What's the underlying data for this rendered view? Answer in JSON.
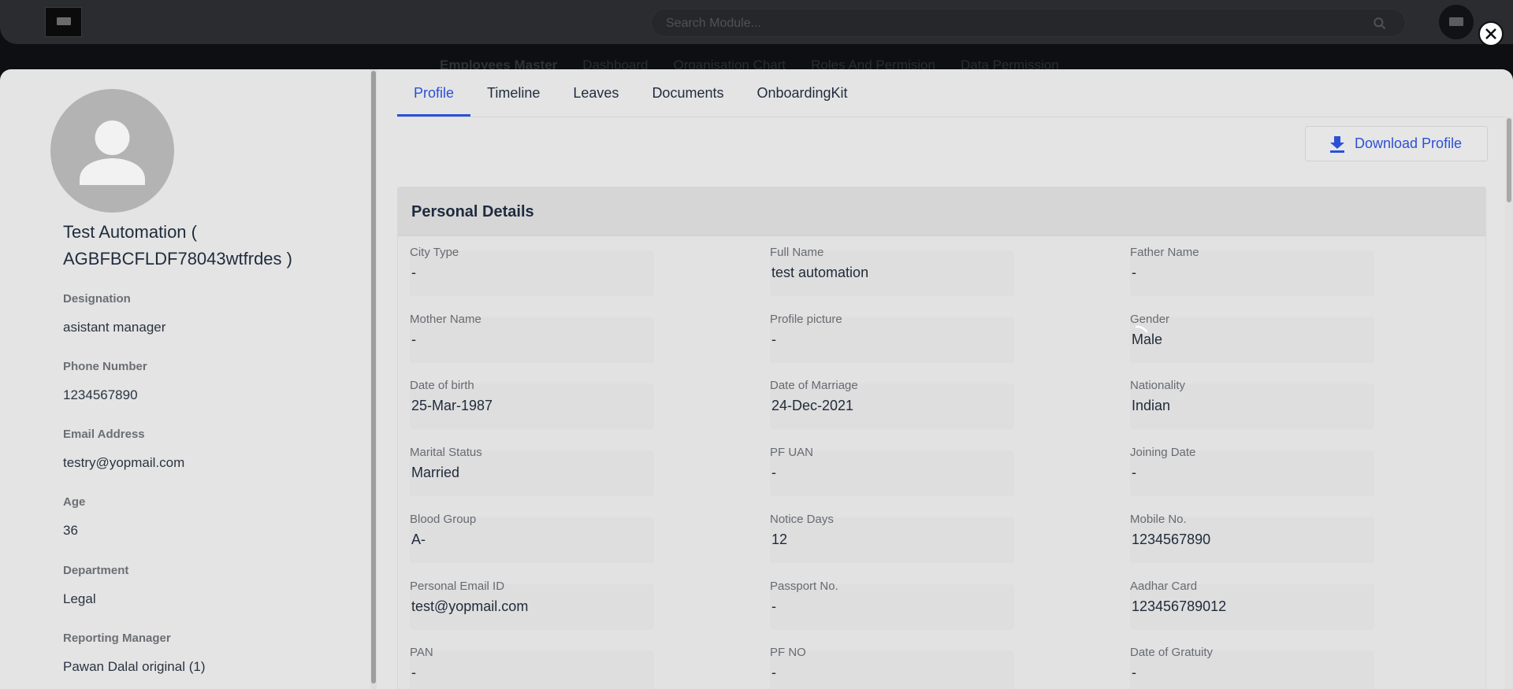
{
  "background": {
    "search_placeholder": "Search Module...",
    "nav": [
      "Employees Master",
      "Dashboard",
      "Organisation Chart",
      "Roles And Permision",
      "Data Permission"
    ]
  },
  "sidebar": {
    "name": "Test Automation ( AGBFBCFLDF78043wtfrdes )",
    "fields": [
      {
        "label": "Designation",
        "value": "asistant manager"
      },
      {
        "label": "Phone Number",
        "value": "1234567890"
      },
      {
        "label": "Email Address",
        "value": "testry@yopmail.com"
      },
      {
        "label": "Age",
        "value": "36"
      },
      {
        "label": "Department",
        "value": "Legal"
      },
      {
        "label": "Reporting Manager",
        "value": "Pawan Dalal original (1)"
      }
    ]
  },
  "tabs": [
    {
      "label": "Profile",
      "active": true
    },
    {
      "label": "Timeline"
    },
    {
      "label": "Leaves"
    },
    {
      "label": "Documents"
    },
    {
      "label": "OnboardingKit"
    }
  ],
  "download_label": "Download Profile",
  "personal": {
    "title": "Personal Details",
    "fields": [
      {
        "label": "City Type",
        "value": "-"
      },
      {
        "label": "Full Name",
        "value": "test automation"
      },
      {
        "label": "Father Name",
        "value": "-"
      },
      {
        "label": "Mother Name",
        "value": "-"
      },
      {
        "label": "Profile picture",
        "value": "-"
      },
      {
        "label": "Gender",
        "value": "Male"
      },
      {
        "label": "Date of birth",
        "value": "25-Mar-1987"
      },
      {
        "label": "Date of Marriage",
        "value": "24-Dec-2021"
      },
      {
        "label": "Nationality",
        "value": "Indian"
      },
      {
        "label": "Marital Status",
        "value": "Married"
      },
      {
        "label": "PF UAN",
        "value": "-"
      },
      {
        "label": "Joining Date",
        "value": "-"
      },
      {
        "label": "Blood Group",
        "value": "A-"
      },
      {
        "label": "Notice Days",
        "value": "12"
      },
      {
        "label": "Mobile No.",
        "value": "1234567890"
      },
      {
        "label": "Personal Email ID",
        "value": "test@yopmail.com"
      },
      {
        "label": "Passport No.",
        "value": "-"
      },
      {
        "label": "Aadhar Card",
        "value": "123456789012"
      },
      {
        "label": "PAN",
        "value": "-"
      },
      {
        "label": "PF NO",
        "value": "-"
      },
      {
        "label": "Date of Gratuity",
        "value": "-"
      }
    ]
  },
  "colors": {
    "accent": "#2b50d8",
    "overlay": "#0d0f12",
    "drawer": "#e4e4e4"
  }
}
